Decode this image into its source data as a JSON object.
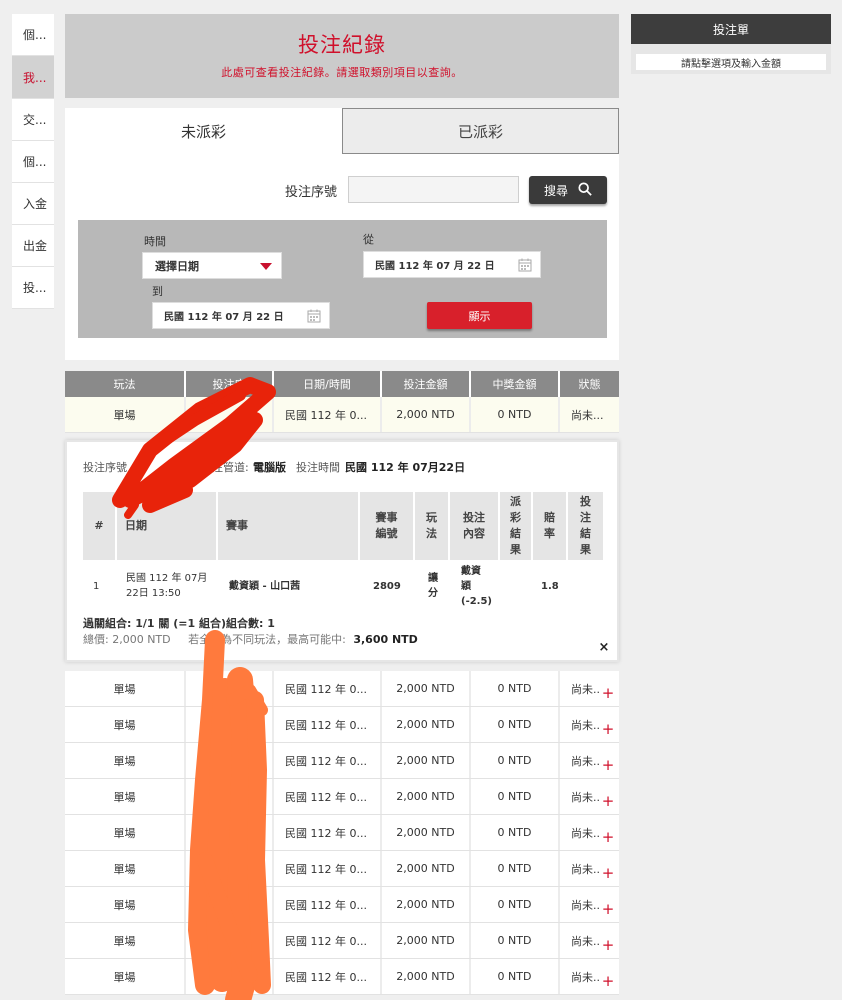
{
  "sidebar": {
    "items": [
      {
        "label": "個..."
      },
      {
        "label": "我..."
      },
      {
        "label": "交..."
      },
      {
        "label": "個..."
      },
      {
        "label": "入金"
      },
      {
        "label": "出金"
      },
      {
        "label": "投..."
      }
    ],
    "active_index": 1
  },
  "header": {
    "title": "投注紀錄",
    "subtitle": "此處可查看投注紀錄。請選取類別項目以查詢。"
  },
  "tabs": [
    {
      "label": "未派彩",
      "selected": true
    },
    {
      "label": "已派彩",
      "selected": false
    }
  ],
  "search": {
    "serial_label": "投注序號",
    "serial_value": "",
    "button_label": "搜尋"
  },
  "filter": {
    "time_label": "時間",
    "time_select": "選擇日期",
    "from_label": "從",
    "from_date": "民國 112 年 07 月 22 日",
    "to_label": "到",
    "to_date": "民國 112 年 07 月 22 日",
    "show_button": "顯示"
  },
  "table": {
    "headers": [
      "玩法",
      "投注序",
      "日期/時間",
      "投注金額",
      "中獎金額",
      "狀態"
    ],
    "rows": [
      {
        "type": "單場",
        "serial": "",
        "datetime": "民國 112 年 0...",
        "amount": "2,000 NTD",
        "win": "0 NTD",
        "status": "尚未..."
      },
      {
        "type": "單場",
        "serial": "",
        "datetime": "民國 112 年 0...",
        "amount": "2,000 NTD",
        "win": "0 NTD",
        "status": "尚未..."
      },
      {
        "type": "單場",
        "serial": "",
        "datetime": "民國 112 年 0...",
        "amount": "2,000 NTD",
        "win": "0 NTD",
        "status": "尚未..."
      },
      {
        "type": "單場",
        "serial": "",
        "datetime": "民國 112 年 0...",
        "amount": "2,000 NTD",
        "win": "0 NTD",
        "status": "尚未..."
      },
      {
        "type": "單場",
        "serial": "",
        "datetime": "民國 112 年 0...",
        "amount": "2,000 NTD",
        "win": "0 NTD",
        "status": "尚未..."
      },
      {
        "type": "單場",
        "serial": "",
        "datetime": "民國 112 年 0...",
        "amount": "2,000 NTD",
        "win": "0 NTD",
        "status": "尚未..."
      },
      {
        "type": "單場",
        "serial": "",
        "datetime": "民國 112 年 0...",
        "amount": "2,000 NTD",
        "win": "0 NTD",
        "status": "尚未..."
      },
      {
        "type": "單場",
        "serial": "",
        "datetime": "民國 112 年 0...",
        "amount": "2,000 NTD",
        "win": "0 NTD",
        "status": "尚未..."
      },
      {
        "type": "單場",
        "serial": "",
        "datetime": "民國 112 年 0...",
        "amount": "2,000 NTD",
        "win": "0 NTD",
        "status": "尚未..."
      },
      {
        "type": "單場",
        "serial": "2",
        "datetime": "民國 112 年 0...",
        "amount": "2,000 NTD",
        "win": "0 NTD",
        "status": "尚未..."
      }
    ]
  },
  "detail": {
    "serial_label": "投注序號",
    "channel_label": "投注管道:",
    "channel_value": "電腦版",
    "time_label": "投注時間",
    "time_value": "民國 112 年 07月22日",
    "columns": [
      "#",
      "日期",
      "賽事",
      "賽事\n編號",
      "玩\n法",
      "投注\n內容",
      "派\n彩\n結\n果",
      "賠\n率",
      "投\n注\n結\n果"
    ],
    "row": {
      "index": "1",
      "date": "民國 112 年 07月\n22日 13:50",
      "match": "戴資穎 - 山口茜",
      "match_no": "2809",
      "play": "讓\n分",
      "content": "戴資\n穎\n(-2.5)",
      "payout_result": "",
      "odds": "1.8",
      "bet_result": ""
    },
    "parlay": "過關組合: 1/1 關 (=1 組合)組合數: 1",
    "total_label": "總價: 2,000 NTD",
    "max_note": "若全數為不同玩法，最高可能中:",
    "max_value": "3,600 NTD",
    "close_symbol": "×"
  },
  "betslip": {
    "title": "投注單",
    "note": "請點擊選項及輸入金額"
  },
  "colors": {
    "brand_red": "#d0102b",
    "header_grey": "#cbcbcb",
    "table_header": "#8a8a8a",
    "dark_button": "#3a3a3a",
    "scribble_red": "#e8230a",
    "scribble_orange": "#ff7a3d"
  }
}
